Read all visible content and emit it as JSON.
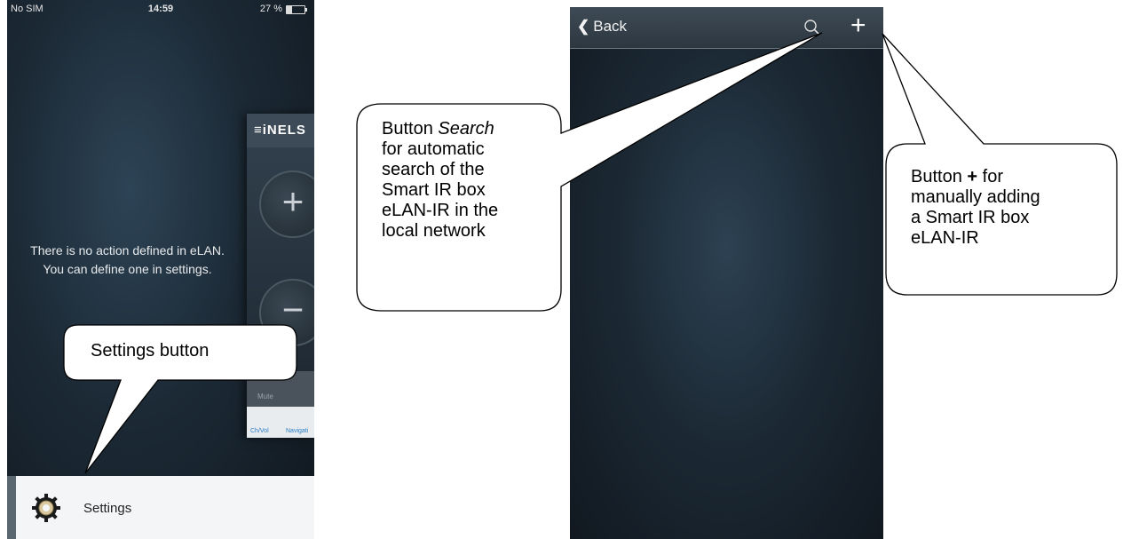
{
  "left_phone": {
    "status": {
      "carrier": "No SIM",
      "time": "14:59",
      "battery": "27 %"
    },
    "empty_message": "There is no action defined in eLAN. You can define one in settings.",
    "peek_app": {
      "logo": "≡iNELS",
      "tabs": [
        "Mute",
        "Ch/Vol",
        "Navigati"
      ]
    },
    "settings": {
      "label": "Settings",
      "icon": "gear-icon"
    }
  },
  "right_phone": {
    "nav": {
      "back_label": "Back",
      "search_icon": "search-icon",
      "add_icon": "plus-icon"
    }
  },
  "callouts": {
    "settings": "Settings button",
    "search": {
      "prefix": "Button ",
      "italic": "Search",
      "rest": [
        "for automatic",
        "search of the",
        "Smart IR box",
        "eLAN-IR in the",
        "local network"
      ]
    },
    "add": {
      "prefix": "Button ",
      "bold": "+",
      "suffix": " for",
      "rest": [
        "manually adding",
        "a Smart IR box",
        "eLAN-IR"
      ]
    }
  }
}
